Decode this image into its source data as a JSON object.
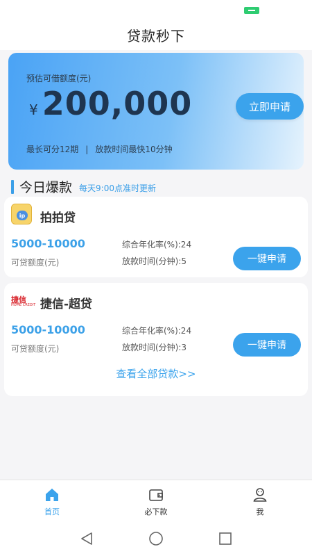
{
  "app": {
    "title": "贷款秒下"
  },
  "hero": {
    "label": "预估可借额度(元)",
    "currency": "¥",
    "amount": "200,000",
    "term_text": "最长可分12期",
    "separator": "|",
    "release_text": "放款时间最快10分钟",
    "apply_label": "立即申请",
    "colors": {
      "accent": "#3ba3ec"
    }
  },
  "section": {
    "title": "今日爆款",
    "subtitle": "每天9:00点准时更新"
  },
  "products": [
    {
      "name": "拍拍贷",
      "logo": "pai-pai-dai-logo",
      "range": "5000-10000",
      "range_label": "可贷额度(元)",
      "rate": "综合年化率(%):24",
      "time": "放款时间(分钟):5",
      "apply_label": "一键申请"
    },
    {
      "name": "捷信-超贷",
      "logo": "home-credit-logo",
      "logo_text": "捷信",
      "logo_subtext": "HOME CREDIT",
      "range": "5000-10000",
      "range_label": "可贷额度(元)",
      "rate": "综合年化率(%):24",
      "time": "放款时间(分钟):3",
      "apply_label": "一键申请"
    }
  ],
  "view_all": "查看全部贷款>>",
  "tabs": [
    {
      "label": "首页",
      "icon": "home-icon",
      "active": true
    },
    {
      "label": "必下款",
      "icon": "wallet-icon",
      "active": false
    },
    {
      "label": "我",
      "icon": "user-icon",
      "active": false
    }
  ],
  "colors": {
    "accent": "#3ba3ec",
    "tab_active": "#3ba3ec",
    "status_battery": "#2ecc71"
  }
}
